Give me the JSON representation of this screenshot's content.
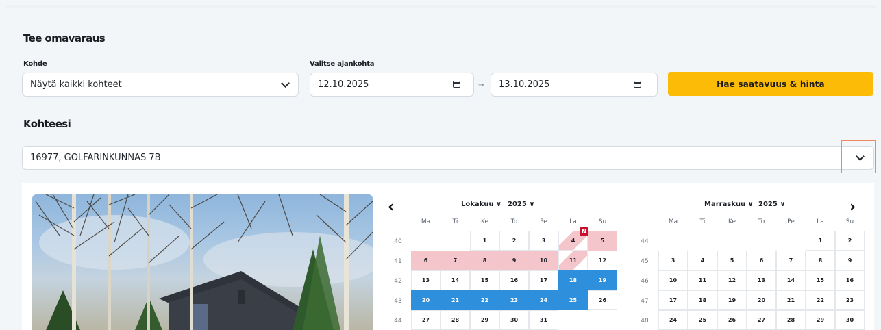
{
  "reservation": {
    "title": "Tee omavaraus",
    "destination_label": "Kohde",
    "destination_value": "Näytä kaikki kohteet",
    "time_label": "Valitse ajankohta",
    "date_from": "12.10.2025",
    "arrow": "→",
    "date_to": "13.10.2025",
    "search_button": "Hae saatavuus & hinta"
  },
  "properties": {
    "title": "Kohteesi",
    "selected": "16977, GOLFARINKUNNAS 7B"
  },
  "calendar": {
    "prev_arrow": "‹",
    "next_arrow": "›",
    "weekdays": [
      "Ma",
      "Ti",
      "Ke",
      "To",
      "Pe",
      "La",
      "Su"
    ],
    "badge": "N",
    "left": {
      "month": "Lokakuu ∨",
      "year": "2025 ∨",
      "weeks": [
        "40",
        "41",
        "42",
        "43",
        "44"
      ],
      "rows": [
        [
          "",
          "",
          "1",
          "2",
          "3",
          "4",
          "5"
        ],
        [
          "6",
          "7",
          "8",
          "9",
          "10",
          "11",
          "12"
        ],
        [
          "13",
          "14",
          "15",
          "16",
          "17",
          "18",
          "19"
        ],
        [
          "20",
          "21",
          "22",
          "23",
          "24",
          "25",
          "26"
        ],
        [
          "27",
          "28",
          "29",
          "30",
          "31",
          "",
          ""
        ]
      ]
    },
    "right": {
      "month": "Marraskuu ∨",
      "year": "2025 ∨",
      "weeks": [
        "44",
        "45",
        "46",
        "47",
        "48"
      ],
      "rows": [
        [
          "",
          "",
          "",
          "",
          "",
          "1",
          "2"
        ],
        [
          "3",
          "4",
          "5",
          "6",
          "7",
          "8",
          "9"
        ],
        [
          "10",
          "11",
          "12",
          "13",
          "14",
          "15",
          "16"
        ],
        [
          "17",
          "18",
          "19",
          "20",
          "21",
          "22",
          "23"
        ],
        [
          "24",
          "25",
          "26",
          "27",
          "28",
          "29",
          "30"
        ]
      ]
    }
  },
  "colors": {
    "accent": "#fcbb06",
    "booked": "#f4c5cb",
    "selected": "#2e8fdc",
    "badge": "#c8102e"
  }
}
